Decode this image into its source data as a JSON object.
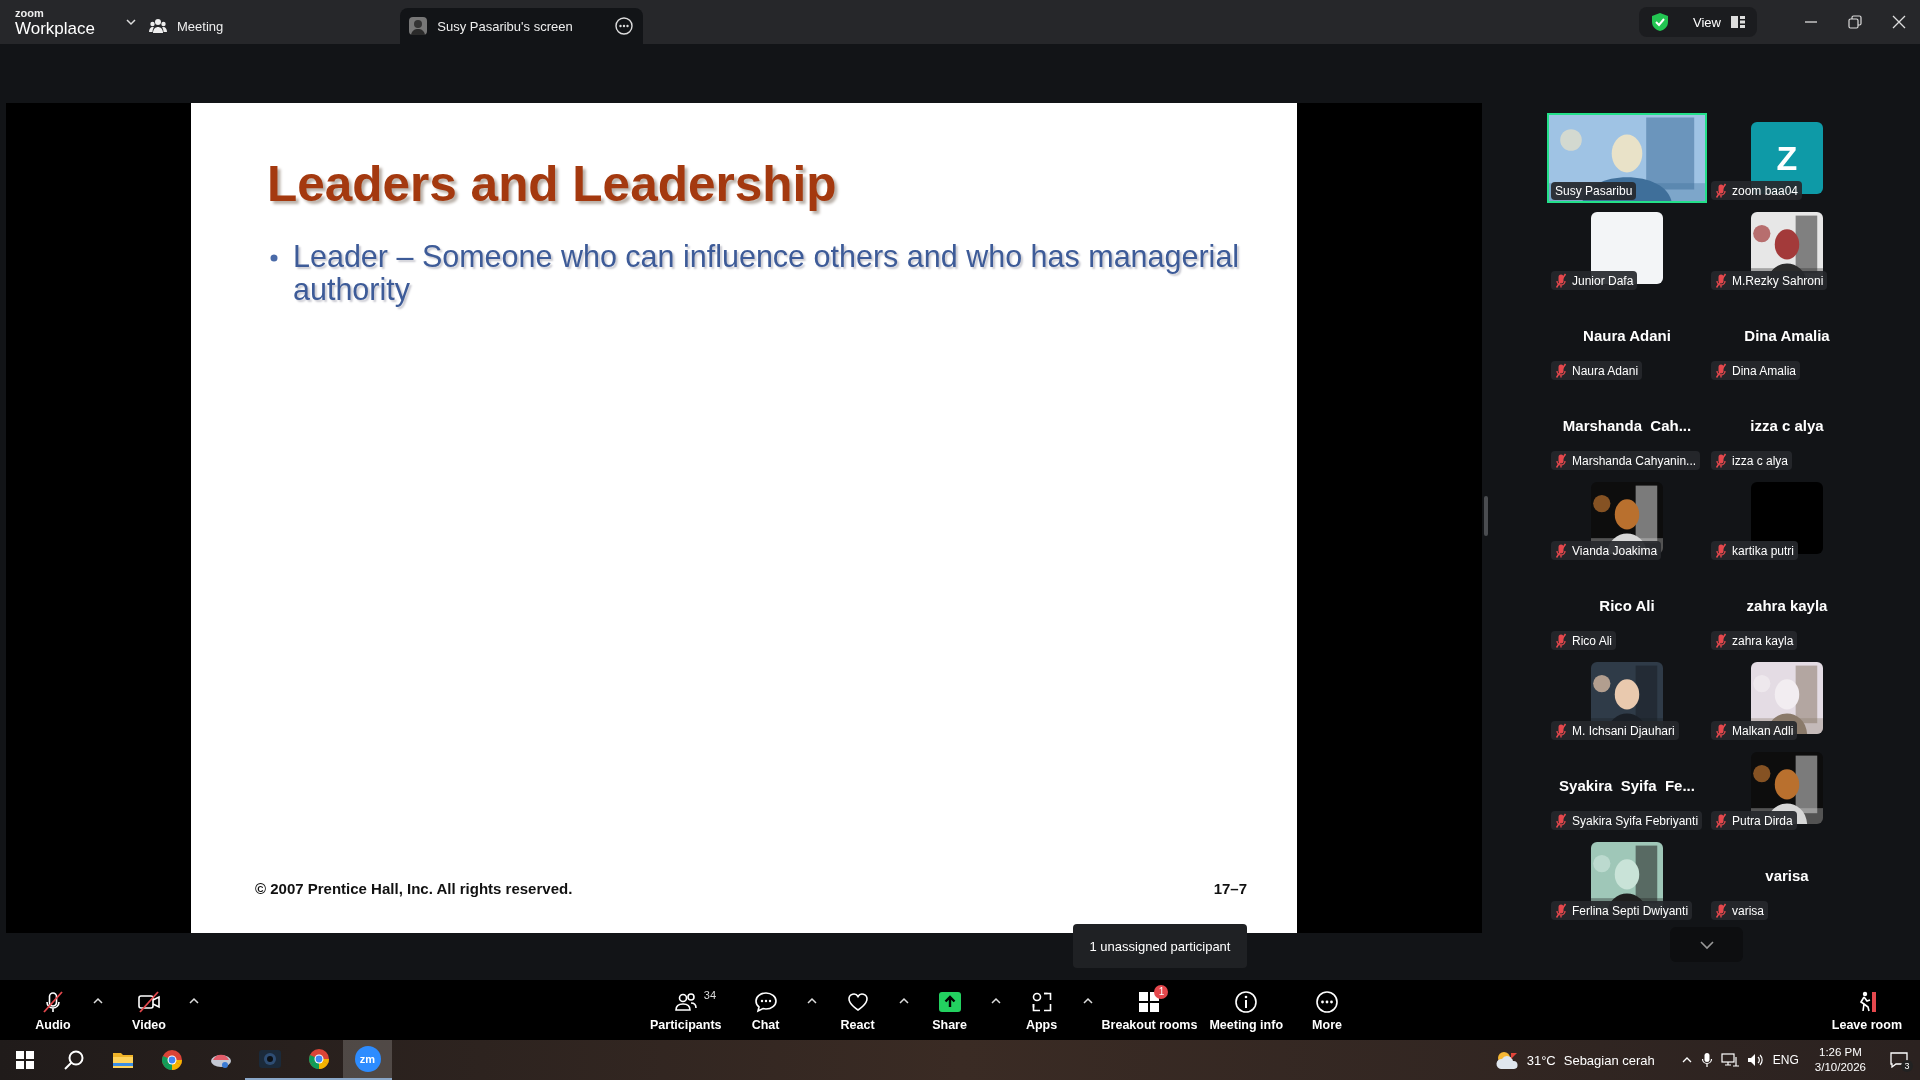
{
  "title_bar": {
    "brand_small": "zoom",
    "brand": "Workplace",
    "tabs": [
      {
        "label": "Meeting",
        "kind": "meeting",
        "selected": false
      },
      {
        "label": "Susy Pasaribu's screen",
        "kind": "screen",
        "selected": true
      }
    ],
    "view_button": "View"
  },
  "slide": {
    "title": "Leaders and Leadership",
    "bullets": [
      "Leader – Someone who can influence others and who has managerial authority"
    ],
    "footer": "© 2007 Prentice Hall, Inc. All rights reserved.",
    "page": "17–7"
  },
  "tooltip": "1 unassigned participant",
  "gallery": {
    "tiles": [
      {
        "name": "Susy Pasaribu",
        "kind": "video",
        "muted": false,
        "speaking": true
      },
      {
        "name": "zoom baa04",
        "kind": "letter",
        "letter": "Z",
        "muted": true,
        "speaking": false
      },
      {
        "name": "Junior Dafa",
        "kind": "blank",
        "muted": true,
        "speaking": false
      },
      {
        "name": "M.Rezky Sahroni",
        "kind": "picture",
        "muted": true,
        "speaking": false
      },
      {
        "name": "Naura Adani",
        "kind": "name",
        "display_name": "Naura Adani",
        "muted": true,
        "speaking": false
      },
      {
        "name": "Dina Amalia",
        "kind": "name",
        "display_name": "Dina Amalia",
        "muted": true,
        "speaking": false
      },
      {
        "name": "Marshanda Cahyanin...",
        "kind": "name",
        "display_name": "Marshanda  Cah...",
        "muted": true,
        "speaking": false
      },
      {
        "name": "izza c alya",
        "kind": "name",
        "display_name": "izza c alya",
        "muted": true,
        "speaking": false
      },
      {
        "name": "Vianda Joakima",
        "kind": "picture",
        "muted": true,
        "speaking": false
      },
      {
        "name": "kartika putri",
        "kind": "dark",
        "muted": true,
        "speaking": false
      },
      {
        "name": "Rico Ali",
        "kind": "name",
        "display_name": "Rico Ali",
        "muted": true,
        "speaking": false
      },
      {
        "name": "zahra kayla",
        "kind": "name",
        "display_name": "zahra kayla",
        "muted": true,
        "speaking": false
      },
      {
        "name": "M. Ichsani Djauhari",
        "kind": "picture",
        "muted": true,
        "speaking": false
      },
      {
        "name": "Malkan Adli",
        "kind": "picture",
        "muted": true,
        "speaking": false
      },
      {
        "name": "Syakira Syifa Febriyanti",
        "kind": "name",
        "display_name": "Syakira  Syifa  Fe...",
        "muted": true,
        "speaking": false
      },
      {
        "name": "Putra Dirda",
        "kind": "picture",
        "muted": true,
        "speaking": false
      },
      {
        "name": "Ferlina Septi Dwiyanti",
        "kind": "picture",
        "muted": true,
        "speaking": false
      },
      {
        "name": "varisa",
        "kind": "name",
        "display_name": "varisa",
        "muted": true,
        "speaking": false
      }
    ]
  },
  "toolbar": {
    "left": [
      {
        "label": "Audio",
        "kind": "audio",
        "off": true,
        "caret": true
      },
      {
        "label": "Video",
        "kind": "video",
        "off": true,
        "caret": true
      }
    ],
    "center": [
      {
        "label": "Participants",
        "kind": "participants",
        "count": "34",
        "off": false,
        "caret": false
      },
      {
        "label": "Chat",
        "kind": "chat",
        "off": false,
        "caret": true
      },
      {
        "label": "React",
        "kind": "react",
        "off": false,
        "caret": true
      },
      {
        "label": "Share",
        "kind": "share",
        "off": false,
        "caret": true
      },
      {
        "label": "Apps",
        "kind": "apps",
        "off": false,
        "caret": true
      },
      {
        "label": "Breakout rooms",
        "kind": "breakout",
        "badge": "1",
        "off": false,
        "caret": false
      },
      {
        "label": "Meeting info",
        "kind": "info",
        "off": false,
        "caret": false
      },
      {
        "label": "More",
        "kind": "more",
        "off": false,
        "caret": false
      }
    ],
    "right": [
      {
        "label": "Leave room",
        "kind": "leave",
        "off": false,
        "caret": false
      }
    ]
  },
  "taskbar": {
    "apps": [
      {
        "kind": "start",
        "running": false,
        "active": false
      },
      {
        "kind": "search",
        "running": false,
        "active": false
      },
      {
        "kind": "explorer",
        "running": false,
        "active": false
      },
      {
        "kind": "chrome",
        "running": false,
        "active": false
      },
      {
        "kind": "app",
        "running": false,
        "active": false
      },
      {
        "kind": "camera",
        "running": true,
        "active": false
      },
      {
        "kind": "chrome",
        "running": true,
        "active": false
      },
      {
        "kind": "zoom",
        "label": "zm",
        "running": true,
        "active": true
      }
    ],
    "temperature": "31°C",
    "weather": "Sebagian cerah",
    "language": "ENG",
    "time": "1:26 PM",
    "date": "3/10/2026",
    "notifications": "3"
  }
}
